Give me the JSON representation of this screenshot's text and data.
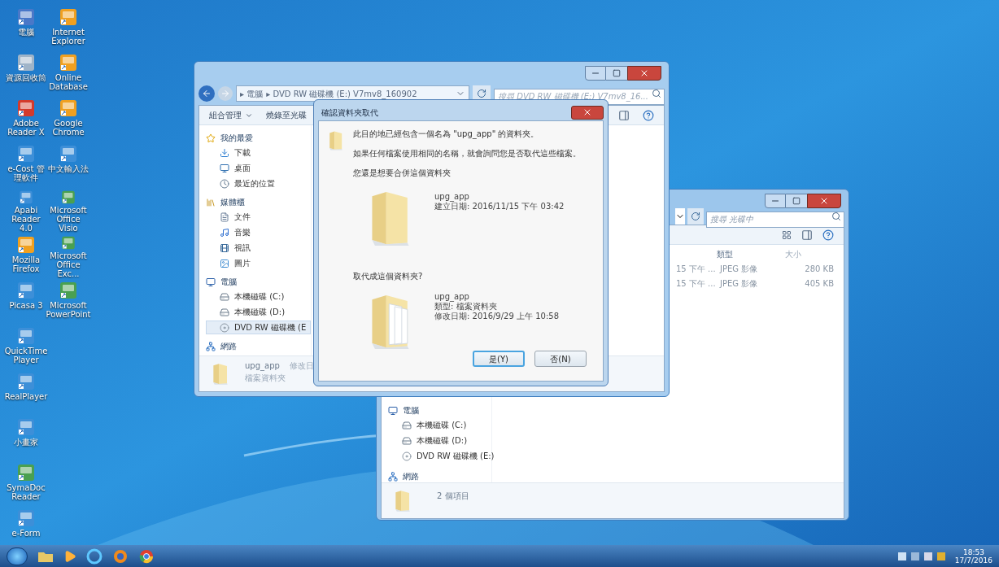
{
  "desktop": {
    "columns": [
      [
        {
          "label": "電腦",
          "kind": "computer"
        },
        {
          "label": "資源回收筒",
          "kind": "bin"
        },
        {
          "label": "Adobe Reader X",
          "kind": "pdf"
        },
        {
          "label": "e-Cost 管理軟件",
          "kind": "app"
        },
        {
          "label": "Apabi Reader 4.0",
          "kind": "app"
        },
        {
          "label": "Mozilla Firefox",
          "kind": "browser"
        },
        {
          "label": "Picasa 3",
          "kind": "app"
        },
        {
          "label": "QuickTime Player",
          "kind": "app"
        },
        {
          "label": "RealPlayer",
          "kind": "app"
        },
        {
          "label": "小畫家",
          "kind": "app"
        },
        {
          "label": "SymaDoc Reader",
          "kind": "doc"
        },
        {
          "label": "e-Form",
          "kind": "app"
        }
      ],
      [
        {
          "label": "Internet Explorer",
          "kind": "browser"
        },
        {
          "label": "Online Database",
          "kind": "browser"
        },
        {
          "label": "Google Chrome",
          "kind": "browser"
        },
        {
          "label": "中文輸入法",
          "kind": "app"
        },
        {
          "label": "Microsoft Office Visio",
          "kind": "doc"
        },
        {
          "label": "Microsoft Office Exc...",
          "kind": "doc"
        },
        {
          "label": "Microsoft PowerPoint",
          "kind": "doc"
        }
      ]
    ]
  },
  "explorer_back": {
    "search": {
      "placeholder": "搜尋 光碟中"
    },
    "columns": [
      "類型",
      "大小"
    ],
    "rows": [
      {
        "date": "15 下午 ...",
        "type": "JPEG 影像",
        "size": "280 KB"
      },
      {
        "date": "15 下午 ...",
        "type": "JPEG 影像",
        "size": "405 KB"
      }
    ],
    "sidebar": [
      {
        "label": "電腦",
        "kind": "computer",
        "children": [
          {
            "label": "本機磁碟 (C:)",
            "kind": "disk",
            "selected": false
          },
          {
            "label": "本機磁碟 (D:)",
            "kind": "disk",
            "selected": false
          },
          {
            "label": "DVD RW 磁碟機 (E:)",
            "kind": "dvd",
            "selected": false
          }
        ]
      },
      {
        "label": "網路",
        "kind": "network"
      }
    ],
    "status": "2 個項目"
  },
  "explorer_front": {
    "address": {
      "separator": "▸",
      "parts": [
        "電腦",
        "DVD RW 磁碟機 (E:) V7mv8_160902"
      ]
    },
    "search": {
      "placeholder": "搜尋 DVD RW 磁碟機 (E:) V7mv8_16..."
    },
    "toolbar": [
      {
        "label": "組合管理",
        "menu": true
      },
      {
        "label": "燒錄至光碟",
        "menu": false
      }
    ],
    "sidebar": [
      {
        "label": "我的最愛",
        "kind": "favorites",
        "children": [
          {
            "label": "下載",
            "kind": "download",
            "selected": false
          },
          {
            "label": "桌面",
            "kind": "desktop",
            "selected": false
          },
          {
            "label": "最近的位置",
            "kind": "recent",
            "selected": false
          }
        ]
      },
      {
        "label": "媒體櫃",
        "kind": "library",
        "children": [
          {
            "label": "文件",
            "kind": "documents",
            "selected": false
          },
          {
            "label": "音樂",
            "kind": "music",
            "selected": false
          },
          {
            "label": "視訊",
            "kind": "video",
            "selected": false
          },
          {
            "label": "圖片",
            "kind": "pictures",
            "selected": false
          }
        ]
      },
      {
        "label": "電腦",
        "kind": "computer",
        "children": [
          {
            "label": "本機磁碟 (C:)",
            "kind": "disk",
            "selected": false
          },
          {
            "label": "本機磁碟 (D:)",
            "kind": "disk",
            "selected": false
          },
          {
            "label": "DVD RW 磁碟機 (E",
            "kind": "dvd",
            "selected": true
          }
        ]
      },
      {
        "label": "網路",
        "kind": "network"
      }
    ],
    "details": {
      "name": "upg_app",
      "meta": "修改日",
      "type": "檔案資料夾"
    }
  },
  "dialog": {
    "title": "確認資料夾取代",
    "lines": [
      "此目的地已經包含一個名為 \"upg_app\" 的資料夾。",
      "如果任何檔案使用相同的名稱，就會詢問您是否取代這些檔案。",
      "您還是想要合併這個資料夾"
    ],
    "existing": {
      "name": "upg_app",
      "lines": [
        "建立日期: 2016/11/15 下午 03:42"
      ]
    },
    "question": "取代成這個資料夾?",
    "incoming": {
      "name": "upg_app",
      "lines": [
        "類型: 檔案資料夾",
        "修改日期: 2016/9/29 上午 10:58"
      ]
    },
    "buttons": [
      {
        "label": "是(Y)",
        "default": true
      },
      {
        "label": "否(N)",
        "default": false
      }
    ]
  },
  "taskbar": {
    "time": "18:53",
    "date": "17/7/2016"
  }
}
